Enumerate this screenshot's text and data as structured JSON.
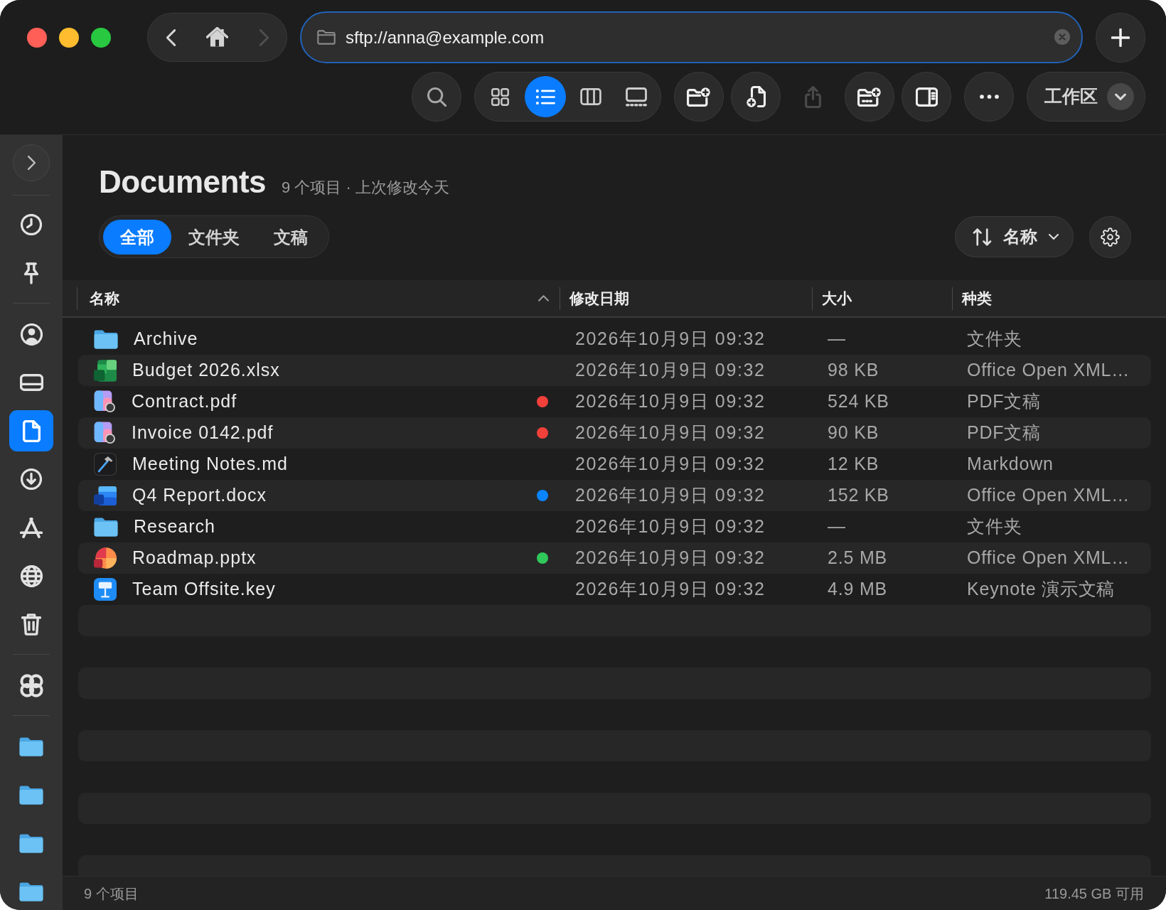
{
  "toolbar": {
    "navigation": [
      {
        "kind": "back",
        "disabled": false
      },
      {
        "kind": "home",
        "disabled": false
      },
      {
        "kind": "forward",
        "disabled": true
      }
    ],
    "address": {
      "value": "sftp://anna@example.com"
    },
    "view_modes": [
      {
        "kind": "icons",
        "selected": false
      },
      {
        "kind": "list",
        "selected": true
      },
      {
        "kind": "columns",
        "selected": false
      },
      {
        "kind": "gallery",
        "selected": false
      }
    ],
    "action_groups": [
      {
        "items": [
          {
            "kind": "new-folder",
            "disabled": false
          },
          {
            "kind": "new-file",
            "disabled": false
          }
        ]
      },
      {
        "items": [
          {
            "kind": "share",
            "disabled": true
          }
        ]
      },
      {
        "items": [
          {
            "kind": "new-folder-with-selection",
            "disabled": false
          },
          {
            "kind": "inspector",
            "disabled": false
          }
        ]
      },
      {
        "items": [
          {
            "kind": "more",
            "disabled": false
          }
        ]
      }
    ],
    "workspace": {
      "label": "工作区"
    }
  },
  "sidebar": {
    "expanded": false,
    "groups": [
      {
        "items": [
          {
            "kind": "recents",
            "selected": false
          },
          {
            "kind": "pinned",
            "selected": false
          }
        ]
      },
      {
        "items": [
          {
            "kind": "account",
            "selected": false
          },
          {
            "kind": "drive",
            "selected": false
          },
          {
            "kind": "documents",
            "selected": true
          },
          {
            "kind": "downloads",
            "selected": false
          },
          {
            "kind": "applications",
            "selected": false
          },
          {
            "kind": "network",
            "selected": false
          },
          {
            "kind": "trash",
            "selected": false
          }
        ]
      },
      {
        "items": [
          {
            "kind": "shared",
            "selected": false
          }
        ]
      },
      {
        "items": [
          {
            "kind": "folder",
            "selected": false
          },
          {
            "kind": "folder",
            "selected": false
          },
          {
            "kind": "folder",
            "selected": false
          },
          {
            "kind": "folder",
            "selected": false
          }
        ]
      }
    ]
  },
  "header": {
    "title": "Documents",
    "subtitle": "9 个项目 · 上次修改今天"
  },
  "filters": [
    {
      "label": "全部",
      "selected": true
    },
    {
      "label": "文件夹",
      "selected": false
    },
    {
      "label": "文稿",
      "selected": false
    }
  ],
  "sort": {
    "label": "名称"
  },
  "table": {
    "columns": [
      {
        "label": "名称",
        "sorted": true
      },
      {
        "label": "修改日期",
        "sorted": false
      },
      {
        "label": "大小",
        "sorted": false
      },
      {
        "label": "种类",
        "sorted": false
      }
    ],
    "rows": [
      {
        "name": "Archive",
        "kind": "folder",
        "modified": "2026年10月9日 09:32",
        "size": "—",
        "type": "文件夹"
      },
      {
        "name": "Budget 2026.xlsx",
        "kind": "spreadsheet",
        "modified": "2026年10月9日 09:32",
        "size": "98 KB",
        "type": "Office Open XML…"
      },
      {
        "name": "Contract.pdf",
        "kind": "pdf",
        "color": "#f2403a",
        "modified": "2026年10月9日 09:32",
        "size": "524 KB",
        "type": "PDF文稿"
      },
      {
        "name": "Invoice 0142.pdf",
        "kind": "pdf",
        "color": "#f2403a",
        "modified": "2026年10月9日 09:32",
        "size": "90 KB",
        "type": "PDF文稿"
      },
      {
        "name": "Meeting Notes.md",
        "kind": "markdown",
        "modified": "2026年10月9日 09:32",
        "size": "12 KB",
        "type": "Markdown"
      },
      {
        "name": "Q4 Report.docx",
        "kind": "document",
        "color": "#0a84ff",
        "modified": "2026年10月9日 09:32",
        "size": "152 KB",
        "type": "Office Open XML…"
      },
      {
        "name": "Research",
        "kind": "folder",
        "modified": "2026年10月9日 09:32",
        "size": "—",
        "type": "文件夹"
      },
      {
        "name": "Roadmap.pptx",
        "kind": "presentation",
        "color": "#30c85a",
        "modified": "2026年10月9日 09:32",
        "size": "2.5 MB",
        "type": "Office Open XML…"
      },
      {
        "name": "Team Offsite.key",
        "kind": "keynote",
        "modified": "2026年10月9日 09:32",
        "size": "4.9 MB",
        "type": "Keynote 演示文稿"
      }
    ]
  },
  "status_bar": {
    "item_count": "9 个项目",
    "free_space": "119.45 GB 可用"
  }
}
